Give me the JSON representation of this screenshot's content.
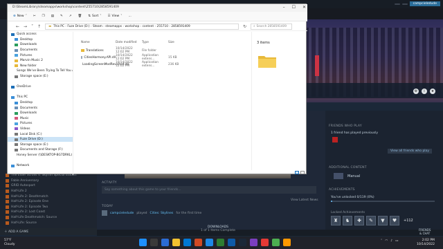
{
  "steam": {
    "top_pills": [
      "",
      "",
      ""
    ],
    "user": "campcieledude",
    "support": "Support",
    "activity": {
      "label": "ACTIVITY",
      "placeholder": "Say something about this game to your friends..."
    },
    "view_latest_news": "View Latest News",
    "today": "TODAY",
    "feed": {
      "user": "campcieledude",
      "action": "played",
      "game": "Cities: Skylines",
      "suffix": "for the first time"
    },
    "friends": {
      "title": "FRIENDS WHO PLAY",
      "count_text": "1 friend has played previously",
      "view_button": "View all friends who play"
    },
    "additional_content": {
      "title": "ADDITIONAL CONTENT",
      "dlc": "Manual"
    },
    "achievements": {
      "title": "ACHIEVEMENTS",
      "unlocked_text": "You've unlocked 0/119 (0%)",
      "progress": 0.0,
      "locked_label": "Locked Achievements",
      "more": "+112"
    },
    "games": [
      "The Elder Scrolls V: Skyrim Special Edition",
      "Fable Anniversary",
      "GRID Autosport",
      "Half-Life 2",
      "Half-Life 2: Deathmatch",
      "Half-Life 2: Episode One",
      "Half-Life 2: Episode Two",
      "Half-Life 2: Lost Coast",
      "Half-Life Deathmatch: Source",
      "Half-Life: Source"
    ],
    "add_game": "ADD A GAME",
    "downloads": {
      "label": "DOWNLOADS",
      "status": "1 of 1 Items Complete"
    },
    "friends_chat": [
      "FRIENDS",
      "& CHAT"
    ]
  },
  "explorer": {
    "title": "D:\\SteamLibrary\\steamapps\\workshop\\content\\255710\\2858591409",
    "toolbar": {
      "new": "New",
      "sort": "Sort",
      "view": "View",
      "more": "..."
    },
    "breadcrumb": [
      "This PC",
      "Fuze Drive (D:)",
      "Steam",
      "steamapps",
      "workshop",
      "content",
      "255710",
      "2858591409"
    ],
    "search_placeholder": "Search 2858591409",
    "nav": [
      {
        "label": "Quick access",
        "indent": 0,
        "icon": "star"
      },
      {
        "label": "Desktop",
        "indent": 1,
        "icon": "desktop"
      },
      {
        "label": "Downloads",
        "indent": 1,
        "icon": "download"
      },
      {
        "label": "Documents",
        "indent": 1,
        "icon": "doc"
      },
      {
        "label": "Pictures",
        "indent": 1,
        "icon": "pic"
      },
      {
        "label": "Marvin Music 2",
        "indent": 1,
        "icon": "folder"
      },
      {
        "label": "New folder",
        "indent": 1,
        "icon": "folder"
      },
      {
        "label": "Songs We've Been Trying To Tell You Abo",
        "indent": 1,
        "icon": "folder"
      },
      {
        "label": "Storage space (E:)",
        "indent": 1,
        "icon": "drive"
      },
      {
        "label": "",
        "indent": 0,
        "icon": "none"
      },
      {
        "label": "OneDrive",
        "indent": 0,
        "icon": "cloud"
      },
      {
        "label": "",
        "indent": 0,
        "icon": "none"
      },
      {
        "label": "This PC",
        "indent": 0,
        "icon": "pc"
      },
      {
        "label": "Desktop",
        "indent": 1,
        "icon": "desktop"
      },
      {
        "label": "Documents",
        "indent": 1,
        "icon": "doc"
      },
      {
        "label": "Downloads",
        "indent": 1,
        "icon": "download"
      },
      {
        "label": "Music",
        "indent": 1,
        "icon": "music"
      },
      {
        "label": "Pictures",
        "indent": 1,
        "icon": "pic"
      },
      {
        "label": "Videos",
        "indent": 1,
        "icon": "video"
      },
      {
        "label": "Local Disk (C:)",
        "indent": 1,
        "icon": "drive"
      },
      {
        "label": "Fuze Drive (D:)",
        "indent": 1,
        "icon": "drive",
        "selected": true
      },
      {
        "label": "Storage space (E:)",
        "indent": 1,
        "icon": "drive"
      },
      {
        "label": "Documents and Storage (F:)",
        "indent": 1,
        "icon": "drive"
      },
      {
        "label": "Honey Server (\\\\DESKTOP-BG7DRKL) (Z:)",
        "indent": 1,
        "icon": "netdrive"
      },
      {
        "label": "",
        "indent": 0,
        "icon": "none"
      },
      {
        "label": "Network",
        "indent": 0,
        "icon": "net"
      }
    ],
    "columns": {
      "name": "Name",
      "date": "Date modified",
      "type": "Type",
      "size": "Size"
    },
    "files": [
      {
        "name": "Translations",
        "date": "10/14/2022 12:02 PM",
        "type": "File folder",
        "size": "",
        "icon": "folder"
      },
      {
        "name": "CitiesHarmony.API.dll",
        "date": "10/14/2022 12:02 PM",
        "type": "Application extens...",
        "size": "15 KB",
        "icon": "dll"
      },
      {
        "name": "LoadingScreenModRevisited.dll",
        "date": "10/14/2022 12:02 PM",
        "type": "Application extens...",
        "size": "236 KB",
        "icon": "dll"
      }
    ],
    "preview": {
      "title": "3 items"
    }
  },
  "taskbar": {
    "weather": [
      "57°F",
      "Cloudy"
    ],
    "clock": [
      "2:02 PM",
      "10/14/2022"
    ],
    "apps": [
      "#1e90ff",
      "#3a3a3a",
      "#2b6cd4",
      "#f2c230",
      "#0078d4",
      "#d14a24",
      "#1e88e5",
      "#2e7d32",
      "#0e5aa7",
      "#1b2838",
      "#7a3fbf",
      "#e53935",
      "#4caf50",
      "#ff9800"
    ]
  }
}
